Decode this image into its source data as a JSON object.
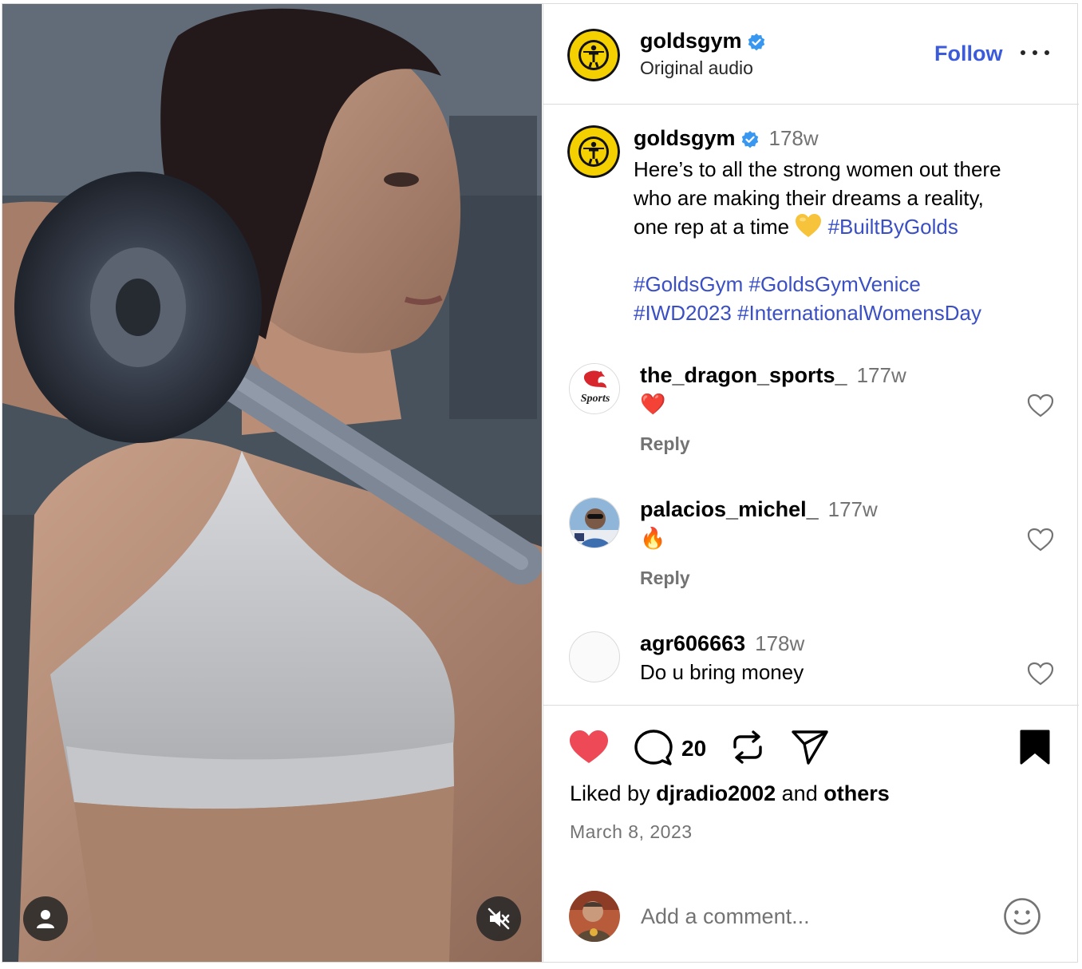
{
  "post": {
    "author": "goldsgym",
    "audio": "Original audio",
    "follow_label": "Follow",
    "caption": {
      "author": "goldsgym",
      "time": "178w",
      "line1": "Here’s to all the strong women out there",
      "line2": "who are making their dreams a reality,",
      "line3_text": "one rep at a time ",
      "line3_tag": "#BuiltByGolds",
      "tags_line1": "#GoldsGym #GoldsGymVenice",
      "tags_line2": "#IWD2023 #InternationalWomensDay"
    }
  },
  "comments": [
    {
      "user": "the_dragon_sports_",
      "time": "177w",
      "text": "❤️",
      "reply": "Reply"
    },
    {
      "user": "palacios_michel_",
      "time": "177w",
      "text": "🔥",
      "reply": "Reply"
    },
    {
      "user": "agr606663",
      "time": "178w",
      "text": "Do u bring money",
      "reply": ""
    }
  ],
  "actions": {
    "comment_count": "20",
    "liked_by_prefix": "Liked by ",
    "liked_by_user": "djradio2002",
    "liked_by_mid": " and ",
    "liked_by_others": "others",
    "date": "March 8, 2023"
  },
  "add_comment": {
    "placeholder": "Add a comment..."
  },
  "icons": {
    "like": "heart-filled-icon",
    "comment": "comment-bubble-icon",
    "repost": "repost-icon",
    "share": "send-icon",
    "save": "bookmark-filled-icon",
    "mute": "speaker-muted-icon",
    "user_tag": "person-icon",
    "verified": "verified-badge-icon",
    "emoji": "smiley-icon"
  },
  "colors": {
    "accent": "#3b5bdb",
    "hashtag": "#3b4fc4",
    "like": "#ed4956",
    "muted_text": "#737373",
    "verified": "#3897f0"
  }
}
